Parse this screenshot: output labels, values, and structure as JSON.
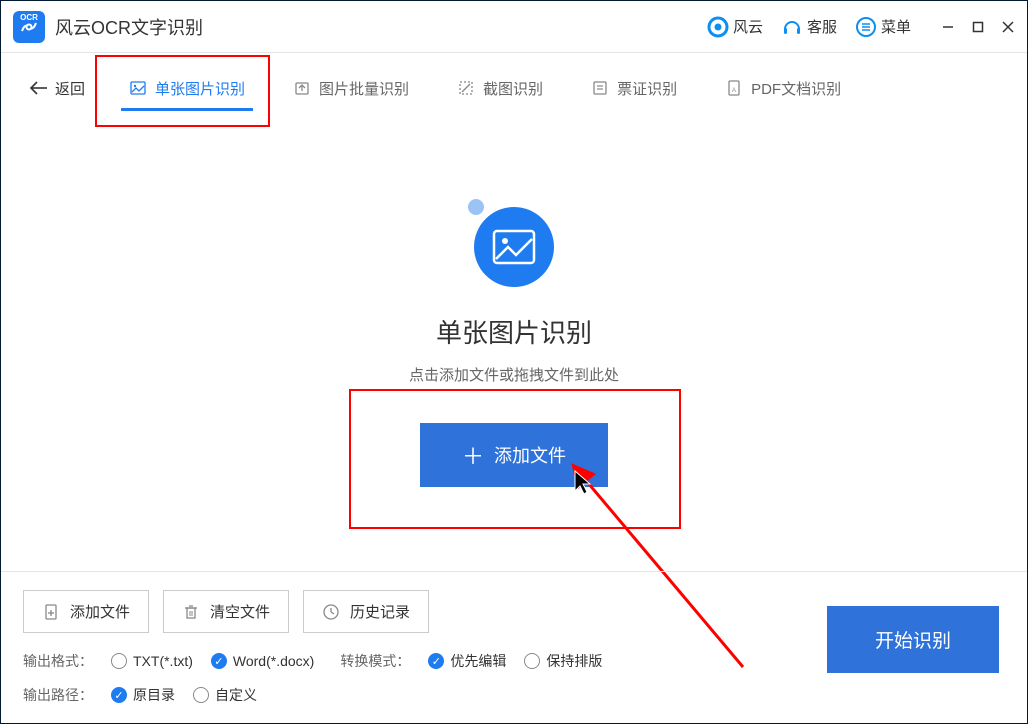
{
  "app": {
    "title": "风云OCR文字识别"
  },
  "header": {
    "fengyun": "风云",
    "support": "客服",
    "menu": "菜单"
  },
  "tabs": {
    "back": "返回",
    "items": [
      {
        "label": "单张图片识别"
      },
      {
        "label": "图片批量识别"
      },
      {
        "label": "截图识别"
      },
      {
        "label": "票证识别"
      },
      {
        "label": "PDF文档识别"
      }
    ]
  },
  "main": {
    "title": "单张图片识别",
    "subtitle": "点击添加文件或拖拽文件到此处",
    "addfile": "添加文件"
  },
  "footer": {
    "addfile": "添加文件",
    "clear": "清空文件",
    "history": "历史记录",
    "outfmt_label": "输出格式：",
    "fmt_txt": "TXT(*.txt)",
    "fmt_word": "Word(*.docx)",
    "mode_label": "转换模式：",
    "mode_edit": "优先编辑",
    "mode_layout": "保持排版",
    "outpath_label": "输出路径：",
    "path_orig": "原目录",
    "path_custom": "自定义",
    "start": "开始识别"
  }
}
